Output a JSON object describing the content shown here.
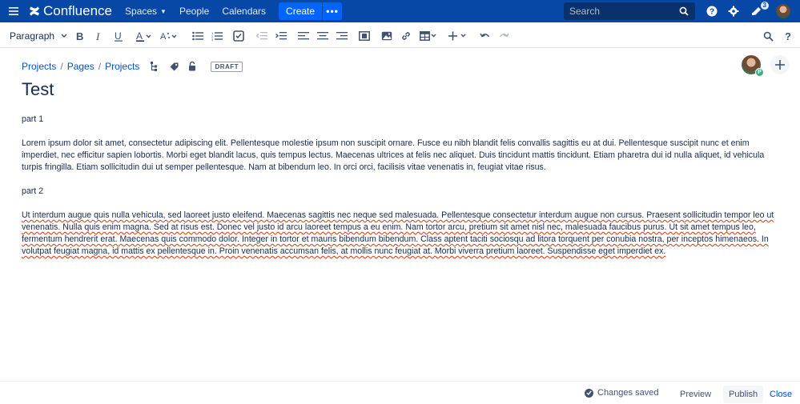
{
  "topnav": {
    "brand": "Confluence",
    "spaces_label": "Spaces",
    "people_label": "People",
    "calendars_label": "Calendars",
    "create_label": "Create",
    "more_label": "•••",
    "search_placeholder": "Search",
    "notifications_count": "3",
    "bg_color": "#0747a6",
    "create_color": "#0065ff"
  },
  "toolbar": {
    "paragraph_label": "Paragraph"
  },
  "breadcrumb": {
    "items": [
      "Projects",
      "Pages",
      "Projects"
    ],
    "draft_label": "DRAFT"
  },
  "collaborator": {
    "initial": "P"
  },
  "page": {
    "title": "Test",
    "heading1": "part 1",
    "paragraph1": "Lorem ipsum dolor sit amet, consectetur adipiscing elit. Pellentesque molestie ipsum non suscipit ornare. Fusce eu nibh blandit felis convallis sagittis eu at dui. Pellentesque suscipit nunc et enim imperdiet, nec efficitur sapien lobortis. Morbi eget blandit lacus, quis tempus lectus. Maecenas ultrices at felis nec aliquet. Duis tincidunt mattis tincidunt. Etiam pharetra dui id nulla aliquet, id vehicula turpis fringilla. Etiam sollicitudin dui ut semper pellentesque. Nam at bibendum leo. In orci orci, facilisis vitae venenatis in, feugiat vitae risus.",
    "heading2": "part 2",
    "paragraph2": "Ut interdum augue quis nulla vehicula, sed laoreet justo eleifend. Maecenas sagittis nec neque sed malesuada. Pellentesque consectetur interdum augue non cursus. Praesent sollicitudin tempor leo ut venenatis. Nulla quis enim magna. Sed at risus est. Donec vel justo id arcu laoreet tempus a eu enim. Nam tortor arcu, pretium sit amet nisl nec, malesuada faucibus purus. Ut sit amet tempus leo, fermentum hendrerit erat. Maecenas quis commodo dolor. Integer in tortor et mauris bibendum bibendum. Class aptent taciti sociosqu ad litora torquent per conubia nostra, per inceptos himenaeos. In volutpat feugiat magna, id mattis ex pellentesque in. Proin venenatis accumsan felis, at mollis nunc feugiat at. Morbi viverra pretium laoreet. Suspendisse eget imperdiet ex."
  },
  "footer": {
    "saved_label": "Changes saved",
    "preview_label": "Preview",
    "publish_label": "Publish",
    "close_label": "Close"
  }
}
